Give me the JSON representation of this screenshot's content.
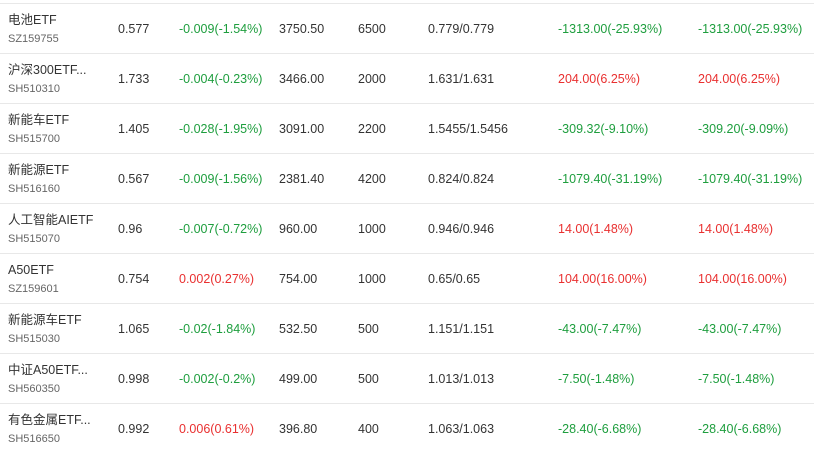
{
  "holdings": [
    {
      "name": "电池ETF",
      "code": "SZ159755",
      "price": "0.577",
      "change": "-0.009(-1.54%)",
      "change_dir": "neg",
      "market_value": "3750.50",
      "quantity": "6500",
      "cost": "0.779/0.779",
      "pnl": "-1313.00(-25.93%)",
      "pnl_dir": "neg",
      "pnl2": "-1313.00(-25.93%)",
      "pnl2_dir": "neg"
    },
    {
      "name": "沪深300ETF...",
      "code": "SH510310",
      "price": "1.733",
      "change": "-0.004(-0.23%)",
      "change_dir": "neg",
      "market_value": "3466.00",
      "quantity": "2000",
      "cost": "1.631/1.631",
      "pnl": "204.00(6.25%)",
      "pnl_dir": "pos",
      "pnl2": "204.00(6.25%)",
      "pnl2_dir": "pos"
    },
    {
      "name": "新能车ETF",
      "code": "SH515700",
      "price": "1.405",
      "change": "-0.028(-1.95%)",
      "change_dir": "neg",
      "market_value": "3091.00",
      "quantity": "2200",
      "cost": "1.5455/1.5456",
      "pnl": "-309.32(-9.10%)",
      "pnl_dir": "neg",
      "pnl2": "-309.20(-9.09%)",
      "pnl2_dir": "neg"
    },
    {
      "name": "新能源ETF",
      "code": "SH516160",
      "price": "0.567",
      "change": "-0.009(-1.56%)",
      "change_dir": "neg",
      "market_value": "2381.40",
      "quantity": "4200",
      "cost": "0.824/0.824",
      "pnl": "-1079.40(-31.19%)",
      "pnl_dir": "neg",
      "pnl2": "-1079.40(-31.19%)",
      "pnl2_dir": "neg"
    },
    {
      "name": "人工智能AIETF",
      "code": "SH515070",
      "price": "0.96",
      "change": "-0.007(-0.72%)",
      "change_dir": "neg",
      "market_value": "960.00",
      "quantity": "1000",
      "cost": "0.946/0.946",
      "pnl": "14.00(1.48%)",
      "pnl_dir": "pos",
      "pnl2": "14.00(1.48%)",
      "pnl2_dir": "pos"
    },
    {
      "name": "A50ETF",
      "code": "SZ159601",
      "price": "0.754",
      "change": "0.002(0.27%)",
      "change_dir": "pos",
      "market_value": "754.00",
      "quantity": "1000",
      "cost": "0.65/0.65",
      "pnl": "104.00(16.00%)",
      "pnl_dir": "pos",
      "pnl2": "104.00(16.00%)",
      "pnl2_dir": "pos"
    },
    {
      "name": "新能源车ETF",
      "code": "SH515030",
      "price": "1.065",
      "change": "-0.02(-1.84%)",
      "change_dir": "neg",
      "market_value": "532.50",
      "quantity": "500",
      "cost": "1.151/1.151",
      "pnl": "-43.00(-7.47%)",
      "pnl_dir": "neg",
      "pnl2": "-43.00(-7.47%)",
      "pnl2_dir": "neg"
    },
    {
      "name": "中证A50ETF...",
      "code": "SH560350",
      "price": "0.998",
      "change": "-0.002(-0.2%)",
      "change_dir": "neg",
      "market_value": "499.00",
      "quantity": "500",
      "cost": "1.013/1.013",
      "pnl": "-7.50(-1.48%)",
      "pnl_dir": "neg",
      "pnl2": "-7.50(-1.48%)",
      "pnl2_dir": "neg"
    },
    {
      "name": "有色金属ETF...",
      "code": "SH516650",
      "price": "0.992",
      "change": "0.006(0.61%)",
      "change_dir": "pos",
      "market_value": "396.80",
      "quantity": "400",
      "cost": "1.063/1.063",
      "pnl": "-28.40(-6.68%)",
      "pnl_dir": "neg",
      "pnl2": "-28.40(-6.68%)",
      "pnl2_dir": "neg"
    }
  ],
  "colors": {
    "up": "#e93030",
    "down": "#1e9e3e",
    "border": "#e8e8e8"
  }
}
